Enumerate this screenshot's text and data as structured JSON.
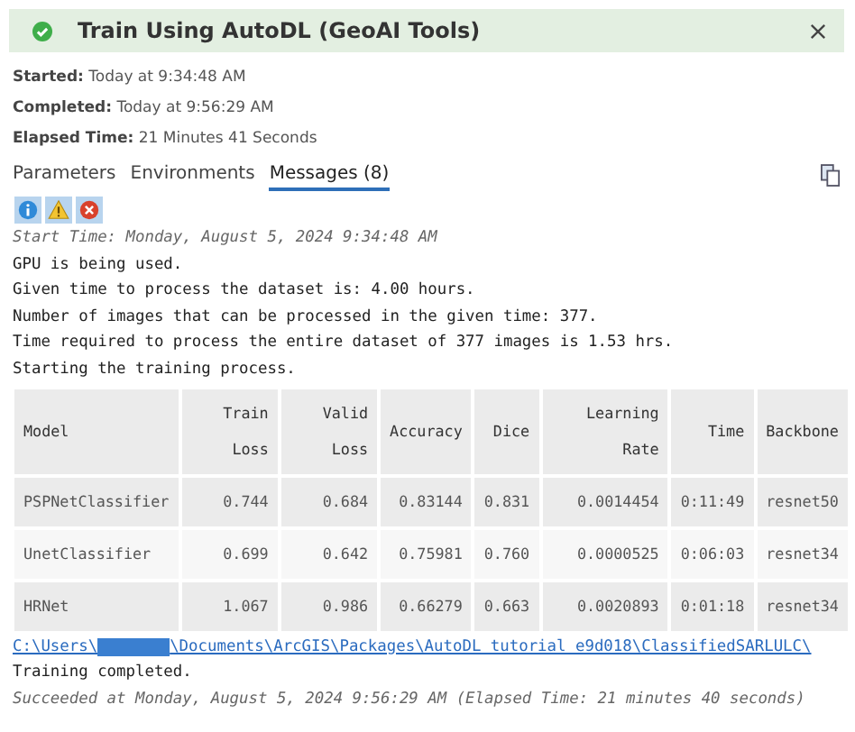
{
  "header": {
    "title": "Train Using AutoDL (GeoAI Tools)"
  },
  "info": [
    {
      "label": "Started:",
      "value": "Today at 9:34:48 AM"
    },
    {
      "label": "Completed:",
      "value": "Today at 9:56:29 AM"
    },
    {
      "label": "Elapsed Time:",
      "value": "21 Minutes 41 Seconds"
    }
  ],
  "tabs": [
    {
      "label": "Parameters",
      "selected": false
    },
    {
      "label": "Environments",
      "selected": false
    },
    {
      "label": "Messages (8)",
      "selected": true
    }
  ],
  "filters": [
    {
      "kind": "info",
      "on": true
    },
    {
      "kind": "warning",
      "on": true
    },
    {
      "kind": "error",
      "on": true
    }
  ],
  "messages": [
    {
      "kind": "time",
      "text": "Start Time: Monday, August 5, 2024 9:34:48 AM"
    },
    {
      "kind": "plain",
      "text": "GPU is being used."
    },
    {
      "kind": "plain",
      "text": "Given time to process the dataset is: 4.00 hours."
    },
    {
      "kind": "plain",
      "text": "Number of images that can be processed in the given time: 377."
    },
    {
      "kind": "plain",
      "text": "Time required to process the entire dataset of 377 images is 1.53 hrs."
    },
    {
      "kind": "plain",
      "text": "Starting the training process."
    }
  ],
  "table": {
    "columns": [
      "Model",
      "Train Loss",
      "Valid Loss",
      "Accuracy",
      "Dice",
      "Learning Rate",
      "Time",
      "Backbone"
    ],
    "rows": [
      [
        "PSPNetClassifier",
        "0.744",
        "0.684",
        "0.83144",
        "0.831",
        "0.0014454",
        "0:11:49",
        "resnet50"
      ],
      [
        "UnetClassifier",
        "0.699",
        "0.642",
        "0.75981",
        "0.760",
        "0.0000525",
        "0:06:03",
        "resnet34"
      ],
      [
        "HRNet",
        "1.067",
        "0.986",
        "0.66279",
        "0.663",
        "0.0020893",
        "0:01:18",
        "resnet34"
      ]
    ]
  },
  "after": [
    {
      "kind": "link",
      "text": "C:\\Users\\",
      "redacted": true,
      "text_after": "\\Documents\\ArcGIS\\Packages\\AutoDL tutorial e9d018\\ClassifiedSARLULC\\"
    },
    {
      "kind": "plain",
      "text": "Training completed."
    },
    {
      "kind": "time",
      "text": "Succeeded at Monday, August 5, 2024 9:56:29 AM (Elapsed Time: 21 minutes 40 seconds)"
    }
  ]
}
